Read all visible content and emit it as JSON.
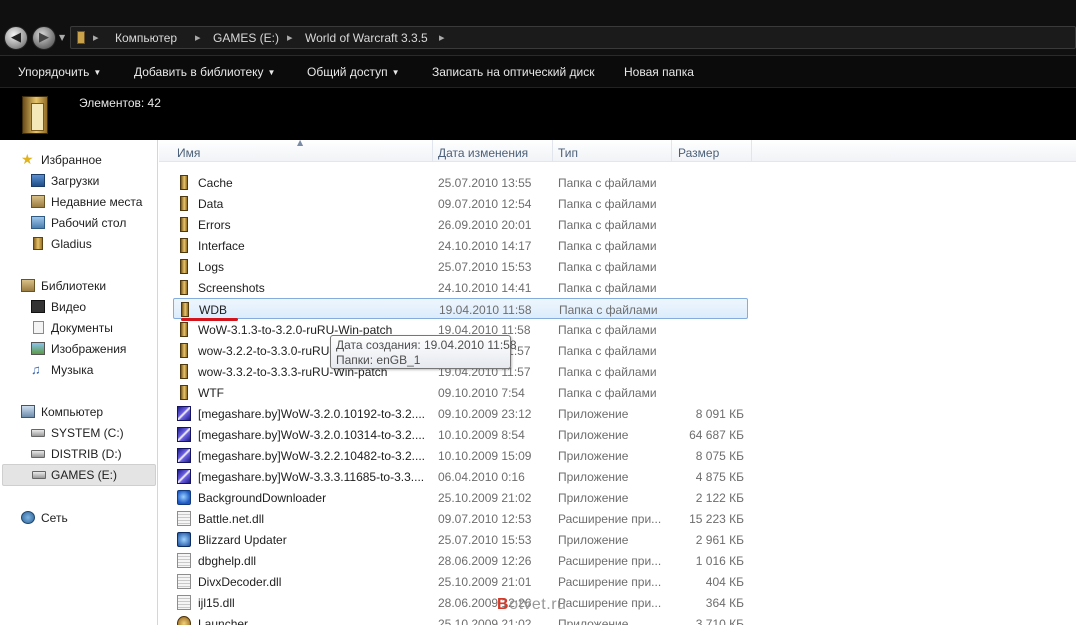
{
  "address": {
    "crumbs": [
      "Компьютер",
      "GAMES (E:)",
      "World of Warcraft 3.3.5"
    ]
  },
  "toolbar": {
    "organize": "Упорядочить",
    "add_to_library": "Добавить в библиотеку",
    "share": "Общий доступ",
    "burn": "Записать на оптический диск",
    "new_folder": "Новая папка"
  },
  "details": {
    "item_count": "Элементов: 42"
  },
  "sidebar": {
    "favorites": "Избранное",
    "downloads": "Загрузки",
    "recent": "Недавние места",
    "desktop": "Рабочий стол",
    "gladius": "Gladius",
    "libraries": "Библиотеки",
    "video": "Видео",
    "documents": "Документы",
    "images": "Изображения",
    "music": "Музыка",
    "computer": "Компьютер",
    "drive_c": "SYSTEM (C:)",
    "drive_d": "DISTRIB (D:)",
    "drive_e": "GAMES (E:)",
    "network": "Сеть"
  },
  "columns": {
    "name": "Имя",
    "date": "Дата изменения",
    "type": "Тип",
    "size": "Размер"
  },
  "files": [
    {
      "name": "Cache",
      "date": "25.07.2010 13:55",
      "type": "Папка с файлами",
      "size": ""
    },
    {
      "name": "Data",
      "date": "09.07.2010 12:54",
      "type": "Папка с файлами",
      "size": ""
    },
    {
      "name": "Errors",
      "date": "26.09.2010 20:01",
      "type": "Папка с файлами",
      "size": ""
    },
    {
      "name": "Interface",
      "date": "24.10.2010 14:17",
      "type": "Папка с файлами",
      "size": ""
    },
    {
      "name": "Logs",
      "date": "25.07.2010 15:53",
      "type": "Папка с файлами",
      "size": ""
    },
    {
      "name": "Screenshots",
      "date": "24.10.2010 14:41",
      "type": "Папка с файлами",
      "size": ""
    },
    {
      "name": "WDB",
      "date": "19.04.2010 11:58",
      "type": "Папка с файлами",
      "size": ""
    },
    {
      "name": "WoW-3.1.3-to-3.2.0-ruRU-Win-patch",
      "date": "19.04.2010 11:58",
      "type": "Папка с файлами",
      "size": ""
    },
    {
      "name": "wow-3.2.2-to-3.3.0-ruRU-Win-patch",
      "date": "19.04.2010 11:57",
      "type": "Папка с файлами",
      "size": ""
    },
    {
      "name": "wow-3.3.2-to-3.3.3-ruRU-Win-patch",
      "date": "19.04.2010 11:57",
      "type": "Папка с файлами",
      "size": ""
    },
    {
      "name": "WTF",
      "date": "09.10.2010 7:54",
      "type": "Папка с файлами",
      "size": ""
    },
    {
      "name": "[megashare.by]WoW-3.2.0.10192-to-3.2....",
      "date": "09.10.2009 23:12",
      "type": "Приложение",
      "size": "8 091 КБ"
    },
    {
      "name": "[megashare.by]WoW-3.2.0.10314-to-3.2....",
      "date": "10.10.2009 8:54",
      "type": "Приложение",
      "size": "64 687 КБ"
    },
    {
      "name": "[megashare.by]WoW-3.2.2.10482-to-3.2....",
      "date": "10.10.2009 15:09",
      "type": "Приложение",
      "size": "8 075 КБ"
    },
    {
      "name": "[megashare.by]WoW-3.3.3.11685-to-3.3....",
      "date": "06.04.2010 0:16",
      "type": "Приложение",
      "size": "4 875 КБ"
    },
    {
      "name": "BackgroundDownloader",
      "date": "25.10.2009 21:02",
      "type": "Приложение",
      "size": "2 122 КБ"
    },
    {
      "name": "Battle.net.dll",
      "date": "09.07.2010 12:53",
      "type": "Расширение при...",
      "size": "15 223 КБ"
    },
    {
      "name": "Blizzard Updater",
      "date": "25.07.2010 15:53",
      "type": "Приложение",
      "size": "2 961 КБ"
    },
    {
      "name": "dbghelp.dll",
      "date": "28.06.2009 12:26",
      "type": "Расширение при...",
      "size": "1 016 КБ"
    },
    {
      "name": "DivxDecoder.dll",
      "date": "25.10.2009 21:01",
      "type": "Расширение при...",
      "size": "404 КБ"
    },
    {
      "name": "ijl15.dll",
      "date": "28.06.2009 12:26",
      "type": "Расширение при...",
      "size": "364 КБ"
    },
    {
      "name": "Launcher",
      "date": "25.10.2009 21:02",
      "type": "Приложение",
      "size": "3 710 КБ"
    }
  ],
  "tooltip": {
    "line1": "Дата создания: 19.04.2010 11:58",
    "line2": "Папки: enGB_1"
  },
  "watermark": {
    "first": "B",
    "rest": "otvet.ru"
  }
}
